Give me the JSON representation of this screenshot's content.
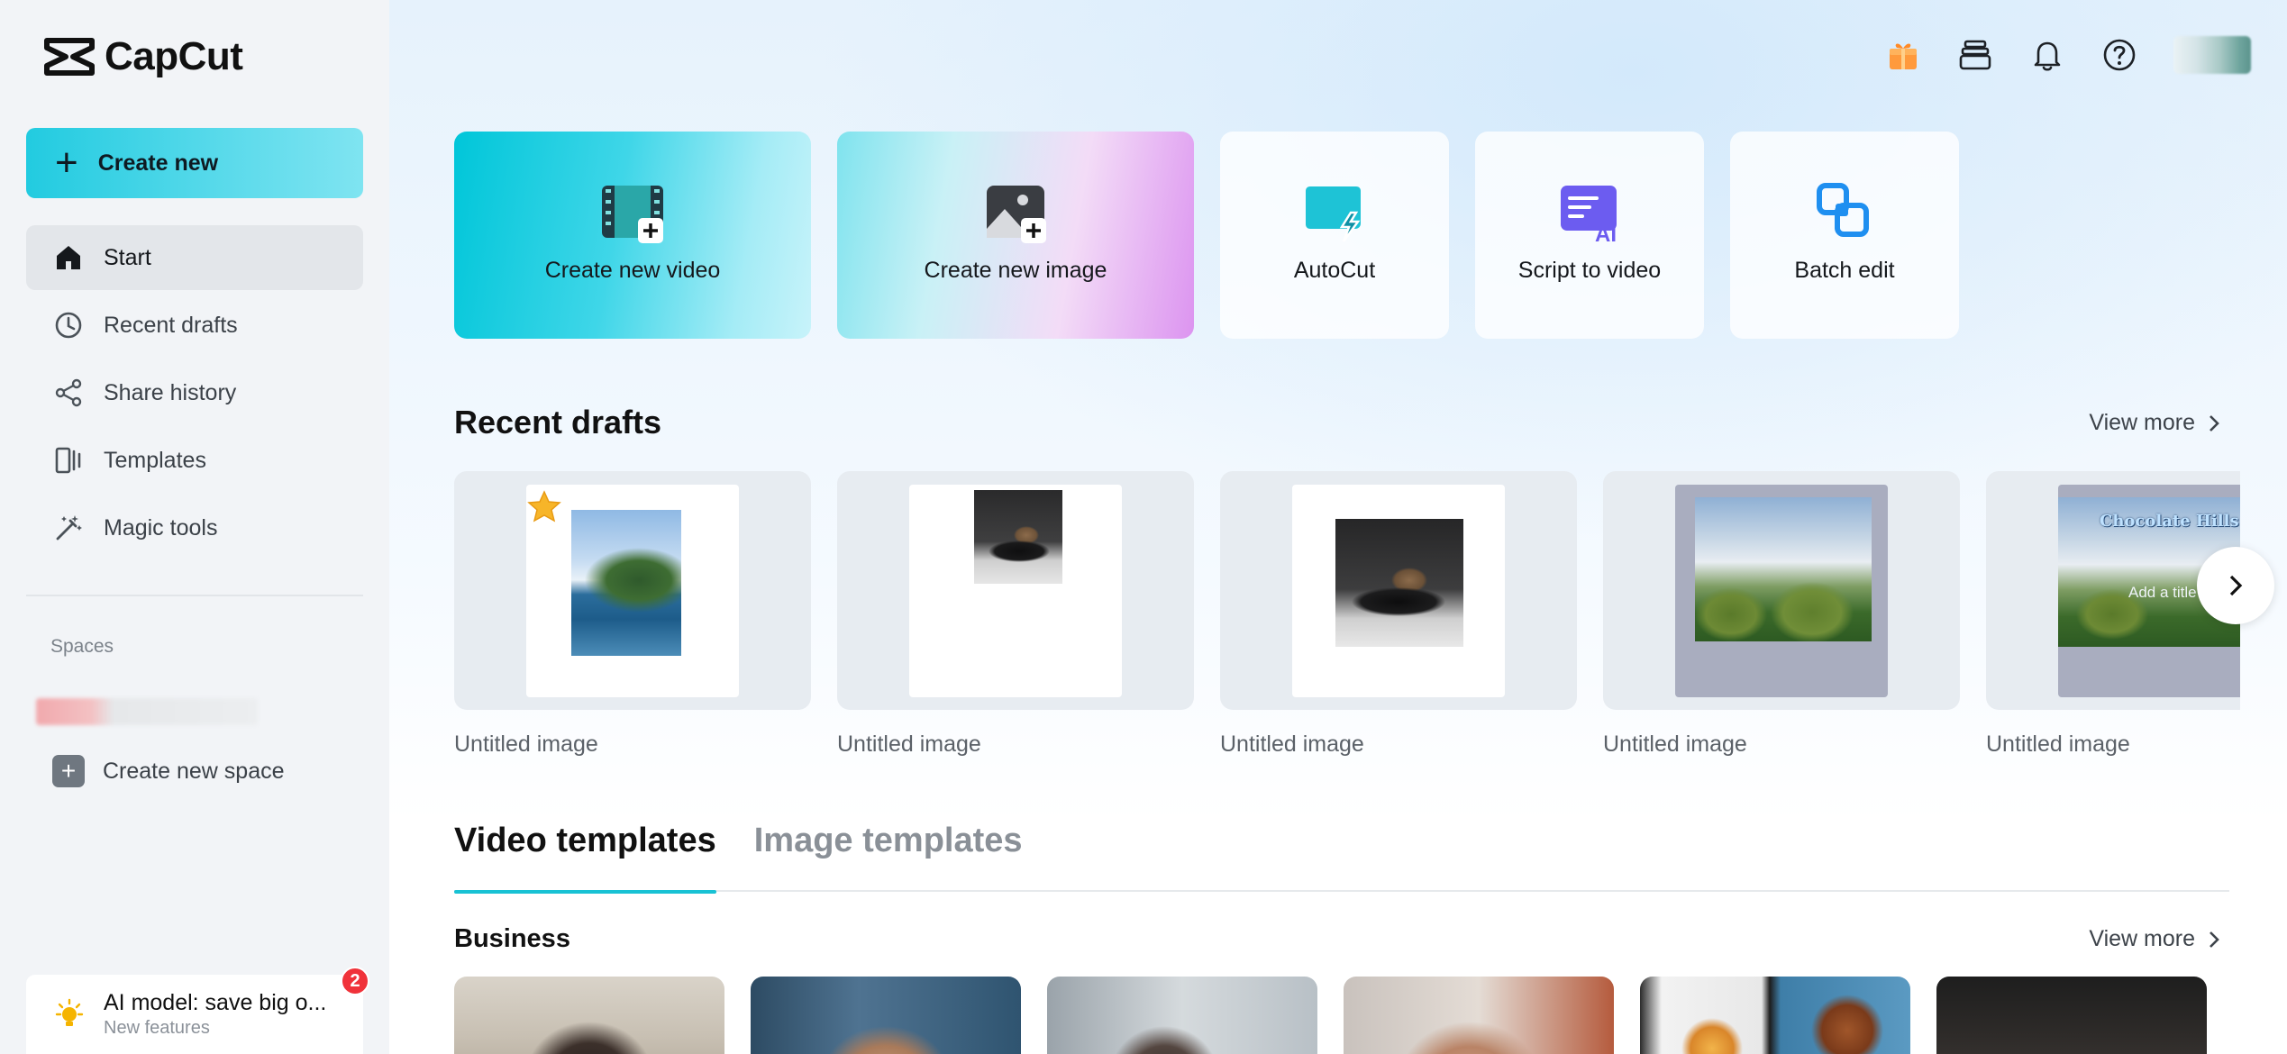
{
  "brand": {
    "name": "CapCut"
  },
  "sidebar": {
    "create_new": "Create new",
    "items": [
      {
        "label": "Start",
        "icon": "home-icon",
        "active": true
      },
      {
        "label": "Recent drafts",
        "icon": "clock-icon"
      },
      {
        "label": "Share history",
        "icon": "share-icon"
      },
      {
        "label": "Templates",
        "icon": "templates-icon"
      },
      {
        "label": "Magic tools",
        "icon": "magic-wand-icon"
      }
    ],
    "spaces_title": "Spaces",
    "create_space": "Create new space",
    "promo": {
      "title": "AI model: save big o...",
      "subtitle": "New features",
      "badge": "2"
    }
  },
  "header": {
    "icons": [
      "gift-icon",
      "stack-icon",
      "bell-icon",
      "help-icon"
    ]
  },
  "quick_actions": [
    {
      "label": "Create new video",
      "icon": "film-plus-icon"
    },
    {
      "label": "Create new image",
      "icon": "image-plus-icon"
    },
    {
      "label": "AutoCut",
      "icon": "autocut-icon"
    },
    {
      "label": "Script to video",
      "icon": "script-ai-icon"
    },
    {
      "label": "Batch edit",
      "icon": "batch-edit-icon"
    }
  ],
  "recent_drafts": {
    "title": "Recent drafts",
    "view_more": "View more",
    "items": [
      {
        "name": "Untitled image",
        "starred": true
      },
      {
        "name": "Untitled image"
      },
      {
        "name": "Untitled image"
      },
      {
        "name": "Untitled image"
      },
      {
        "name": "Untitled image",
        "overlay_title": "Chocolate Hills",
        "overlay_subtitle": "Add a title"
      }
    ]
  },
  "template_tabs": [
    {
      "label": "Video templates",
      "active": true
    },
    {
      "label": "Image templates",
      "active": false
    }
  ],
  "business": {
    "title": "Business",
    "view_more": "View more"
  },
  "colors": {
    "accent": "#18c2d4",
    "badge": "#f0323a",
    "sidebar_bg": "#f2f4f7"
  }
}
